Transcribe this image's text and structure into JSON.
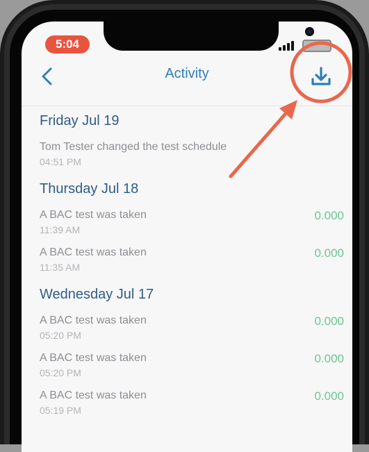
{
  "status_bar": {
    "time": "5:04"
  },
  "nav": {
    "title": "Activity",
    "back_icon": "chevron-left-icon",
    "download_icon": "download-icon"
  },
  "colors": {
    "accent": "#2e7eb8",
    "value_green": "#6cc68e",
    "annotation": "#e9674c"
  },
  "days": [
    {
      "label": "Friday Jul 19",
      "entries": [
        {
          "text": "Tom Tester changed the test schedule",
          "time": "04:51 PM",
          "value": ""
        }
      ]
    },
    {
      "label": "Thursday Jul 18",
      "entries": [
        {
          "text": "A BAC test was taken",
          "time": "11:39 AM",
          "value": "0.000"
        },
        {
          "text": "A BAC test was taken",
          "time": "11:35 AM",
          "value": "0.000"
        }
      ]
    },
    {
      "label": "Wednesday Jul 17",
      "entries": [
        {
          "text": "A BAC test was taken",
          "time": "05:20 PM",
          "value": "0.000"
        },
        {
          "text": "A BAC test was taken",
          "time": "05:20 PM",
          "value": "0.000"
        },
        {
          "text": "A BAC test was taken",
          "time": "05:19 PM",
          "value": "0.000"
        }
      ]
    }
  ]
}
